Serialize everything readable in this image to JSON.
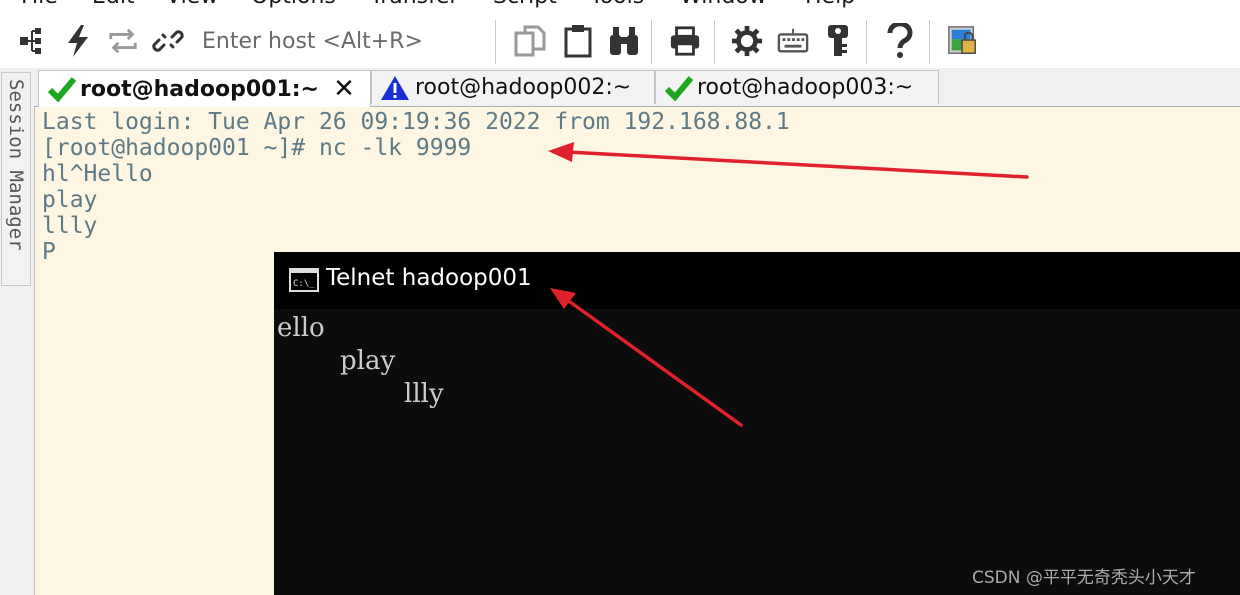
{
  "menubar": {
    "items": [
      {
        "label": "File"
      },
      {
        "label": "Edit"
      },
      {
        "label": "View"
      },
      {
        "label": "Options"
      },
      {
        "label": "Transfer"
      },
      {
        "label": "Script"
      },
      {
        "label": "Tools"
      },
      {
        "label": "Window"
      },
      {
        "label": "Help"
      }
    ]
  },
  "toolbar": {
    "host_placeholder": "Enter host <Alt+R>"
  },
  "sidebar": {
    "session_manager_label": "Session Manager"
  },
  "tabs": [
    {
      "label": "root@hadoop001:~",
      "status": "connected",
      "status_icon": "checkmark-icon",
      "status_color": "#1fa81f",
      "active": true
    },
    {
      "label": "root@hadoop002:~",
      "status": "warning",
      "status_icon": "warning-triangle-icon",
      "status_color": "#1a2fd8",
      "active": false
    },
    {
      "label": "root@hadoop003:~",
      "status": "connected",
      "status_icon": "checkmark-icon",
      "status_color": "#1fa81f",
      "active": false
    }
  ],
  "terminal": {
    "lines": [
      "Last login: Tue Apr 26 09:19:36 2022 from 192.168.88.1",
      "[root@hadoop001 ~]# nc -lk 9999",
      "hl^Hello",
      "play",
      "llly",
      "P"
    ]
  },
  "telnet_window": {
    "title": "Telnet hadoop001",
    "lines": [
      "ello",
      "play",
      "llly"
    ]
  },
  "watermark": "CSDN @平平无奇秃头小天才",
  "colors": {
    "terminal_bg": "#fdf6e3",
    "terminal_fg": "#5d7a86",
    "telnet_bg": "#0c0c0c",
    "arrow": "#e0202a"
  }
}
